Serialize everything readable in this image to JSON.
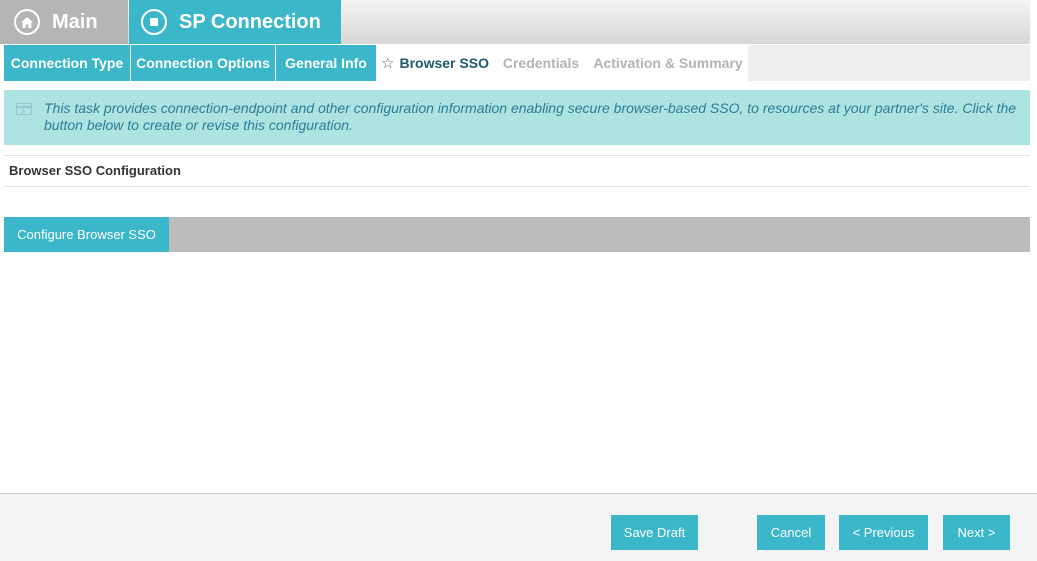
{
  "header": {
    "main_label": "Main",
    "main_icon": "home-icon",
    "sp_label": "SP Connection",
    "sp_icon": "stop-circle-icon"
  },
  "steps": [
    {
      "label": "Connection Type",
      "state": "done"
    },
    {
      "label": "Connection Options",
      "state": "done"
    },
    {
      "label": "General Info",
      "state": "done"
    },
    {
      "label": "Browser SSO",
      "state": "active",
      "icon": "star-icon"
    },
    {
      "label": "Credentials",
      "state": "pending"
    },
    {
      "label": "Activation & Summary",
      "state": "pending"
    }
  ],
  "info": {
    "icon": "info-panel-icon",
    "text": "This task provides connection-endpoint and other configuration information enabling secure browser-based SSO, to resources at your partner's site. Click the button below to create or revise this configuration."
  },
  "section": {
    "title": "Browser SSO Configuration",
    "configure_label": "Configure Browser SSO"
  },
  "footer": {
    "save_draft": "Save Draft",
    "cancel": "Cancel",
    "previous": "< Previous",
    "next": "Next >"
  },
  "colors": {
    "accent": "#3bb7c9",
    "inactive_tab": "#b5b5b5",
    "info_bg": "#ade3e1",
    "info_text": "#2c7d97",
    "active_step_text": "#1e5a6e",
    "pending_step_text": "#b3b3b3"
  }
}
